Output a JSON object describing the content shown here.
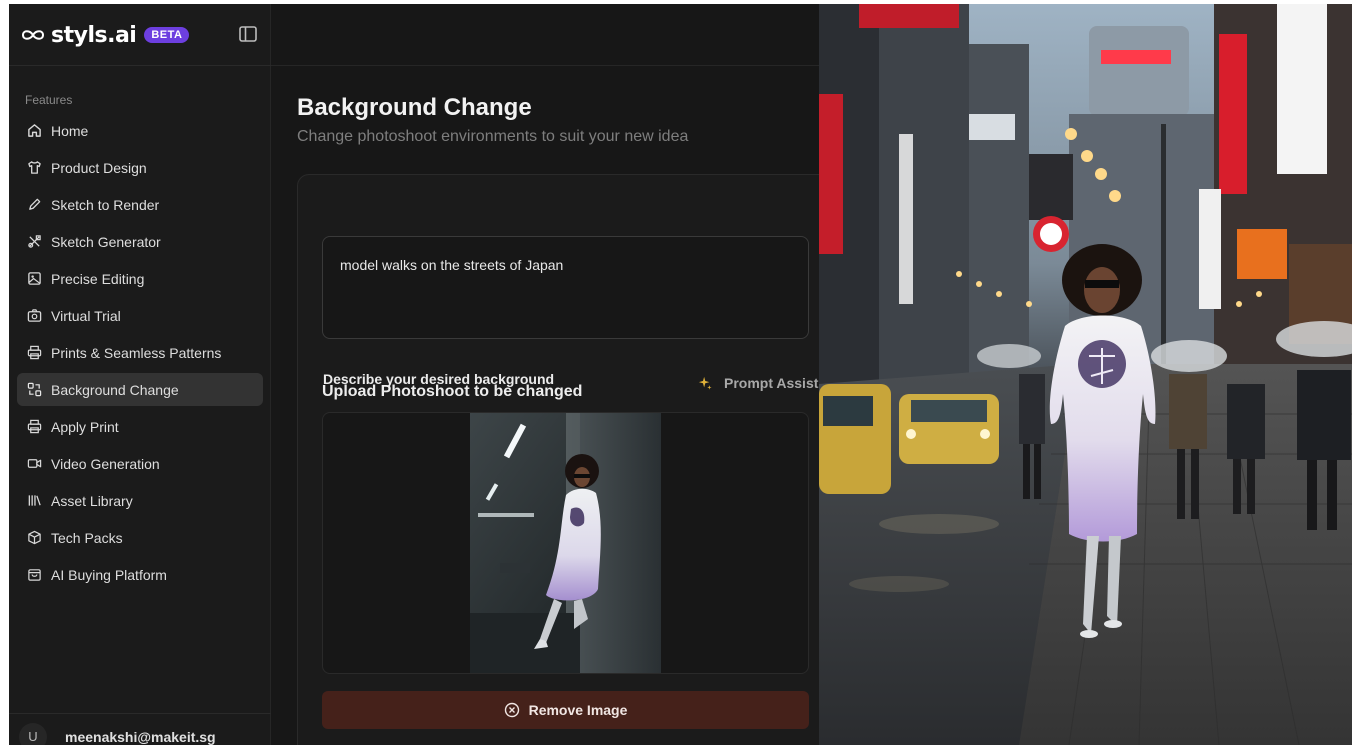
{
  "brand": {
    "name": "styls.ai",
    "badge": "BETA"
  },
  "sidebar": {
    "section_label": "Features",
    "items": [
      {
        "label": "Home",
        "icon": "home-icon"
      },
      {
        "label": "Product Design",
        "icon": "shirt-icon"
      },
      {
        "label": "Sketch to Render",
        "icon": "pencil-icon"
      },
      {
        "label": "Sketch Generator",
        "icon": "tools-icon"
      },
      {
        "label": "Precise Editing",
        "icon": "image-edit-icon"
      },
      {
        "label": "Virtual Trial",
        "icon": "camera-icon"
      },
      {
        "label": "Prints & Seamless Patterns",
        "icon": "printer-icon"
      },
      {
        "label": "Background Change",
        "icon": "swap-icon",
        "active": true
      },
      {
        "label": "Apply Print",
        "icon": "printer-icon"
      },
      {
        "label": "Video Generation",
        "icon": "video-icon"
      },
      {
        "label": "Asset Library",
        "icon": "library-icon"
      },
      {
        "label": "Tech Packs",
        "icon": "box-icon"
      },
      {
        "label": "AI Buying Platform",
        "icon": "shopping-bag-icon"
      }
    ],
    "user": {
      "initial": "U",
      "email": "meenakshi@makeit.sg"
    }
  },
  "main": {
    "title": "Background Change",
    "subtitle": "Change photoshoot environments to suit your new idea",
    "prompt": {
      "label": "Describe your desired background",
      "assist_label": "Prompt Assist",
      "value": "model walks on the streets of Japan"
    },
    "upload": {
      "label": "Upload Photoshoot to be changed",
      "remove_label": "Remove Image"
    }
  },
  "colors": {
    "accent": "#6d3fe0",
    "active_item": "#333333",
    "remove_button": "#45211a",
    "background": "#171717"
  }
}
